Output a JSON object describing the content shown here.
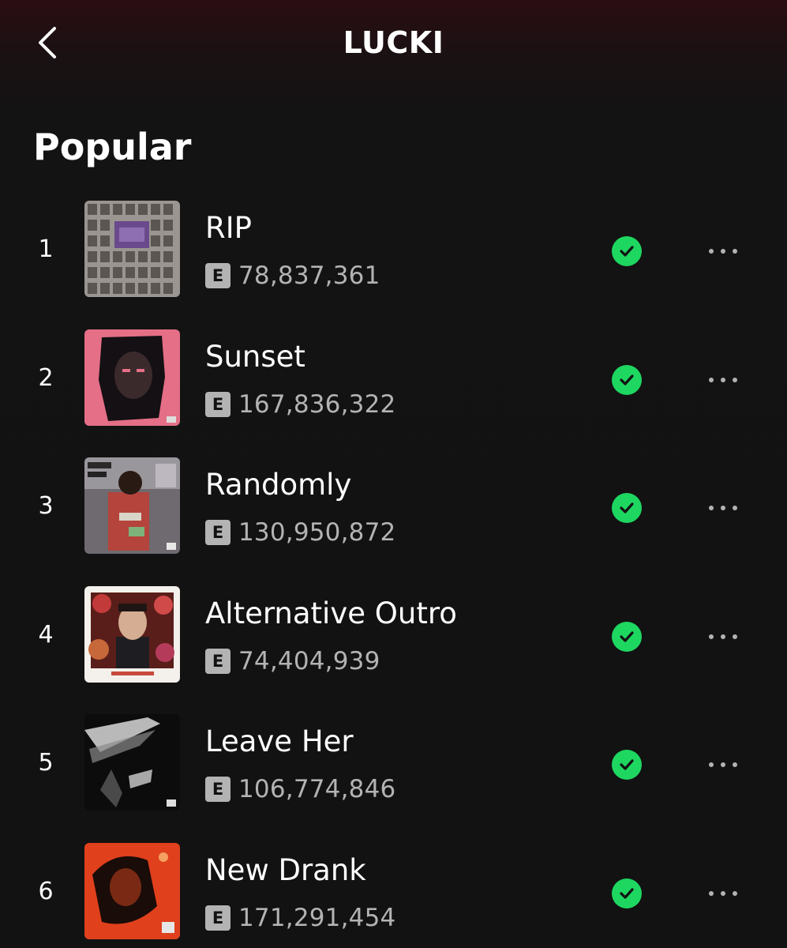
{
  "header": {
    "title": "LUCKI",
    "back_icon": "chevron-left-icon"
  },
  "section": {
    "heading": "Popular"
  },
  "colors": {
    "background": "#121212",
    "header_tint": "#2a0d12",
    "accent_green": "#1ed760",
    "secondary_text": "#b3b3b3"
  },
  "tracks": [
    {
      "rank": "1",
      "title": "RIP",
      "explicit": "E",
      "plays": "78,837,361",
      "saved": true,
      "cover_art": "gray-photo-grid-cover"
    },
    {
      "rank": "2",
      "title": "Sunset",
      "explicit": "E",
      "plays": "167,836,322",
      "saved": true,
      "cover_art": "pink-portrait-cover"
    },
    {
      "rank": "3",
      "title": "Randomly",
      "explicit": "E",
      "plays": "130,950,872",
      "saved": true,
      "cover_art": "street-photo-cover"
    },
    {
      "rank": "4",
      "title": "Alternative Outro",
      "explicit": "E",
      "plays": "74,404,939",
      "saved": true,
      "cover_art": "alternative-trap-cover"
    },
    {
      "rank": "5",
      "title": "Leave Her",
      "explicit": "E",
      "plays": "106,774,846",
      "saved": true,
      "cover_art": "black-white-leave-her-cover"
    },
    {
      "rank": "6",
      "title": "New Drank",
      "explicit": "E",
      "plays": "171,291,454",
      "saved": true,
      "cover_art": "red-orange-portrait-cover"
    }
  ]
}
